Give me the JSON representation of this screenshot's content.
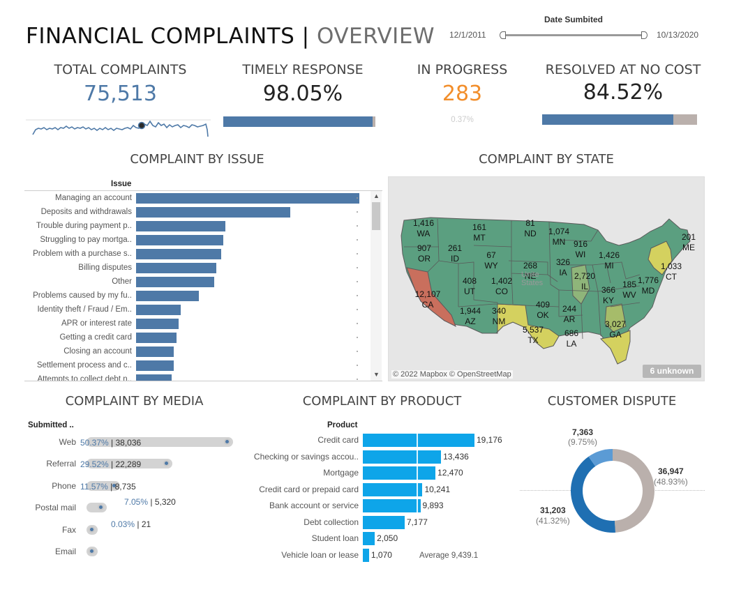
{
  "title": {
    "part1": "FINANCIAL COMPLAINTS",
    "sep": "|",
    "part2": "OVERVIEW"
  },
  "date_filter": {
    "label": "Date Sumbited",
    "start": "12/1/2011",
    "end": "10/13/2020"
  },
  "kpis": {
    "total": {
      "title": "TOTAL COMPLAINTS",
      "value": "75,513",
      "color": "#4e79a7"
    },
    "timely": {
      "title": "TIMELY RESPONSE",
      "value": "98.05%",
      "progress": 0.98
    },
    "inprogress": {
      "title": "IN PROGRESS",
      "value": "283",
      "sub": "0.37%",
      "color": "#f28e2b"
    },
    "resolved": {
      "title": "RESOLVED AT NO COST",
      "value": "84.52%",
      "progress": 0.845
    }
  },
  "issue": {
    "title": "COMPLAINT BY ISSUE",
    "header": "Issue",
    "items": [
      {
        "label": "Managing an account",
        "value": 1
      },
      {
        "label": "Deposits and withdrawals",
        "value": 0.69
      },
      {
        "label": "Trouble during payment p..",
        "value": 0.4
      },
      {
        "label": "Struggling to pay mortga..",
        "value": 0.39
      },
      {
        "label": "Problem with a purchase s..",
        "value": 0.38
      },
      {
        "label": "Billing disputes",
        "value": 0.36
      },
      {
        "label": "Other",
        "value": 0.35
      },
      {
        "label": "Problems caused by my fu..",
        "value": 0.28
      },
      {
        "label": "Identity theft / Fraud / Em..",
        "value": 0.2
      },
      {
        "label": "APR or interest rate",
        "value": 0.19
      },
      {
        "label": "Getting a credit card",
        "value": 0.18
      },
      {
        "label": "Closing an account",
        "value": 0.17
      },
      {
        "label": "Settlement process and c..",
        "value": 0.17
      },
      {
        "label": "Attempts to collect debt n..",
        "value": 0.16
      }
    ]
  },
  "state": {
    "title": "COMPLAINT BY STATE",
    "credit": "© 2022 Mapbox © OpenStreetMap",
    "unknown": "6 unknown",
    "labels": [
      {
        "v": "1,416",
        "s": "WA"
      },
      {
        "v": "907",
        "s": "OR"
      },
      {
        "v": "261",
        "s": "ID"
      },
      {
        "v": "161",
        "s": "MT"
      },
      {
        "v": "67",
        "s": "WY"
      },
      {
        "v": "81",
        "s": "ND"
      },
      {
        "v": "1,074",
        "s": "MN"
      },
      {
        "v": "916",
        "s": "WI"
      },
      {
        "v": "1,426",
        "s": "MI"
      },
      {
        "v": "201",
        "s": "ME"
      },
      {
        "v": "268",
        "s": "NE"
      },
      {
        "v": "326",
        "s": "IA"
      },
      {
        "v": "2,720",
        "s": "IL"
      },
      {
        "v": "1,033",
        "s": "CT"
      },
      {
        "v": "1,776",
        "s": "MD"
      },
      {
        "v": "12,107",
        "s": "CA"
      },
      {
        "v": "408",
        "s": "UT"
      },
      {
        "v": "1,402",
        "s": "CO"
      },
      {
        "v": "366",
        "s": "KY"
      },
      {
        "v": "185",
        "s": "WV"
      },
      {
        "v": "1,944",
        "s": "AZ"
      },
      {
        "v": "340",
        "s": "NM"
      },
      {
        "v": "409",
        "s": "OK"
      },
      {
        "v": "244",
        "s": "AR"
      },
      {
        "v": "5,537",
        "s": "TX"
      },
      {
        "v": "686",
        "s": "LA"
      },
      {
        "v": "3,027",
        "s": "GA"
      }
    ]
  },
  "media": {
    "title": "COMPLAINT BY MEDIA",
    "header": "Submitted ..",
    "items": [
      {
        "label": "Web",
        "pct": "50.37%",
        "count": "38,036",
        "share": 0.5037
      },
      {
        "label": "Referral",
        "pct": "29.52%",
        "count": "22,289",
        "share": 0.2952
      },
      {
        "label": "Phone",
        "pct": "11.57%",
        "count": "8,735",
        "share": 0.1157
      },
      {
        "label": "Postal mail",
        "pct": "7.05%",
        "count": "5,320",
        "share": 0.0705
      },
      {
        "label": "Fax",
        "pct": "0.03%",
        "count": "21",
        "share": 0.0003
      },
      {
        "label": "Email",
        "pct": "",
        "count": "",
        "share": 0
      }
    ]
  },
  "product": {
    "title": "COMPLAINT BY PRODUCT",
    "header": "Product",
    "average": "Average 9,439.1",
    "items": [
      {
        "label": "Credit card",
        "value": 19176,
        "text": "19,176"
      },
      {
        "label": "Checking or savings accou..",
        "value": 13436,
        "text": "13,436"
      },
      {
        "label": "Mortgage",
        "value": 12470,
        "text": "12,470"
      },
      {
        "label": "Credit card or prepaid card",
        "value": 10241,
        "text": "10,241"
      },
      {
        "label": "Bank account or service",
        "value": 9893,
        "text": "9,893"
      },
      {
        "label": "Debt collection",
        "value": 7177,
        "text": "7,177"
      },
      {
        "label": "Student loan",
        "value": 2050,
        "text": "2,050"
      },
      {
        "label": "Vehicle loan or lease",
        "value": 1070,
        "text": "1,070"
      }
    ]
  },
  "dispute": {
    "title": "CUSTOMER DISPUTE",
    "slices": [
      {
        "value": "36,947",
        "pct": "(48.93%)",
        "share": 0.4893,
        "color": "#bab0ac"
      },
      {
        "value": "31,203",
        "pct": "(41.32%)",
        "share": 0.4132,
        "color": "#1f6fb2"
      },
      {
        "value": "7,363",
        "pct": "(9.75%)",
        "share": 0.0975,
        "color": "#5b9bd5"
      }
    ]
  }
}
